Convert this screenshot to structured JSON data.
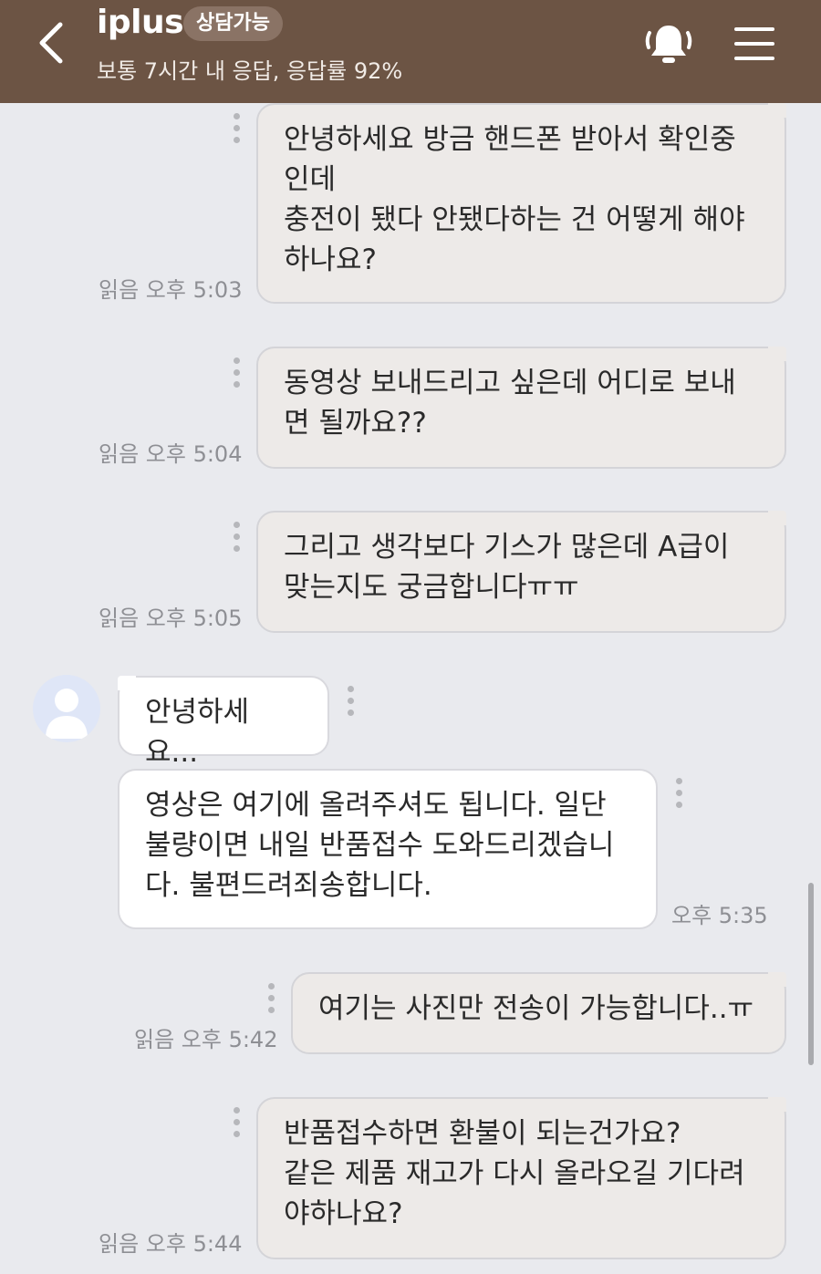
{
  "header": {
    "title": "iplus",
    "badge": "상담가능",
    "subtitle": "보통 7시간 내 응답, 응답률 92%"
  },
  "messages": [
    {
      "lines": [
        "안녕하세요 방금 핸드폰 받아서 확인중",
        "인데",
        "충전이 됐다 안됐다하는 건 어떻게 해야",
        "하나요?"
      ],
      "status": "읽음 오후 5:03"
    },
    {
      "lines": [
        "동영상 보내드리고 싶은데 어디로 보내",
        "면 될까요??"
      ],
      "status": "읽음 오후 5:04"
    },
    {
      "lines": [
        "그리고 생각보다 기스가 많은데 A급이",
        "맞는지도 궁금합니다ㅠㅠ"
      ],
      "status": "읽음 오후 5:05"
    },
    {
      "lines": [
        "안녕하세요..."
      ],
      "status": ""
    },
    {
      "lines": [
        "영상은 여기에 올려주셔도 됩니다. 일단",
        "불량이면 내일 반품접수 도와드리겠습니",
        "다. 불편드려죄송합니다."
      ],
      "status": "오후 5:35"
    },
    {
      "lines": [
        "여기는 사진만 전송이 가능합니다..ㅠ"
      ],
      "status": "읽음 오후 5:42"
    },
    {
      "lines": [
        "반품접수하면 환불이 되는건가요?",
        "같은 제품 재고가 다시 올라오길 기다려",
        "야하나요?"
      ],
      "status": "읽음 오후 5:44"
    }
  ],
  "colors": {
    "header_bg": "#6c5444",
    "chat_bg": "#e9eaee",
    "outgoing_bubble": "#edeae8",
    "incoming_bubble": "#ffffff"
  },
  "icons": [
    "back-arrow-icon",
    "bell-icon",
    "hamburger-menu-icon",
    "more-options-icon",
    "default-avatar-icon"
  ]
}
